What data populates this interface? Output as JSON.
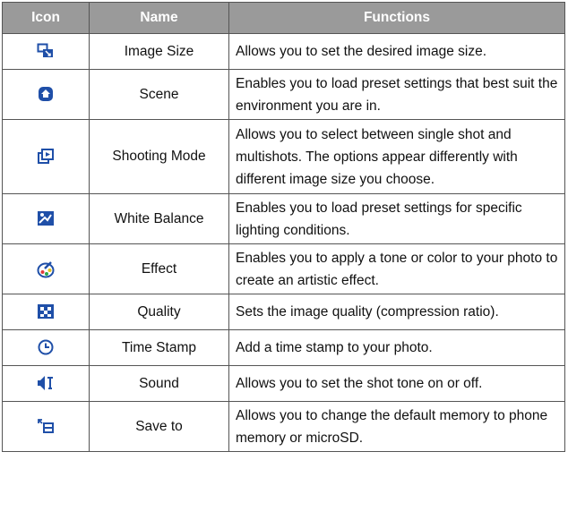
{
  "table": {
    "headers": [
      "Icon",
      "Name",
      "Functions"
    ],
    "rows": [
      {
        "icon": "image-size-icon",
        "name": "Image Size",
        "function": "Allows you to set the desired image size."
      },
      {
        "icon": "scene-icon",
        "name": "Scene",
        "function": "Enables you to load preset settings that best suit the environment you are in."
      },
      {
        "icon": "shooting-mode-icon",
        "name": "Shooting Mode",
        "function": "Allows you to select between single shot and multishots. The options appear differently with different image size you choose."
      },
      {
        "icon": "white-balance-icon",
        "name": "White Balance",
        "function": "Enables you to load preset settings for specific lighting conditions."
      },
      {
        "icon": "effect-icon",
        "name": "Effect",
        "function": "Enables you to apply a tone or color to your photo to create an artistic effect."
      },
      {
        "icon": "quality-icon",
        "name": "Quality",
        "function": "Sets the image quality (compression ratio)."
      },
      {
        "icon": "time-stamp-icon",
        "name": "Time Stamp",
        "function": "Add a time stamp to your photo."
      },
      {
        "icon": "sound-icon",
        "name": "Sound",
        "function": "Allows you to set the shot tone on or off."
      },
      {
        "icon": "save-to-icon",
        "name": "Save to",
        "function": "Allows you to change the default memory to phone memory or microSD."
      }
    ]
  },
  "colors": {
    "header_bg": "#9a9a9a",
    "header_text": "#ffffff",
    "icon_blue": "#1f4fa8"
  }
}
